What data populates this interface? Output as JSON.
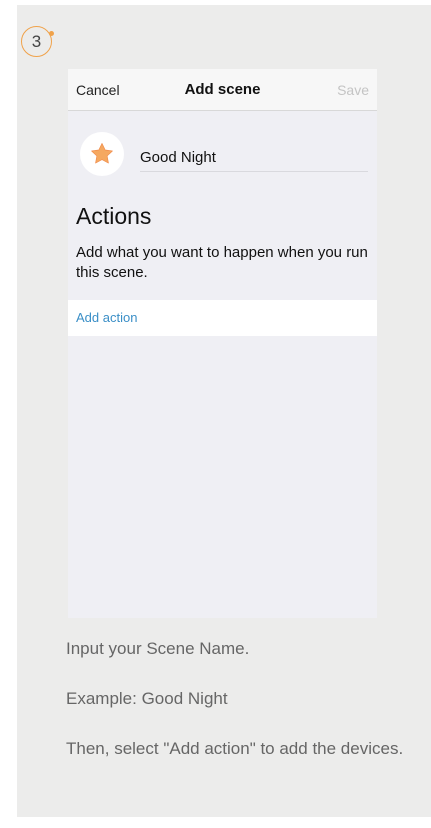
{
  "step": {
    "number": "3"
  },
  "nav": {
    "cancel": "Cancel",
    "title": "Add scene",
    "save": "Save"
  },
  "scene": {
    "icon": "star-icon",
    "name": "Good Night"
  },
  "actions": {
    "heading": "Actions",
    "description": "Add what you want to happen when you run this scene.",
    "add_label": "Add action"
  },
  "instructions": [
    "Input your Scene Name.",
    "Example: Good Night",
    "Then, select \"Add action\" to add the devices."
  ],
  "colors": {
    "accent": "#f0a24a",
    "link": "#3b8fc7",
    "card_bg": "#ececeb",
    "disabled": "#c4c4c4"
  }
}
